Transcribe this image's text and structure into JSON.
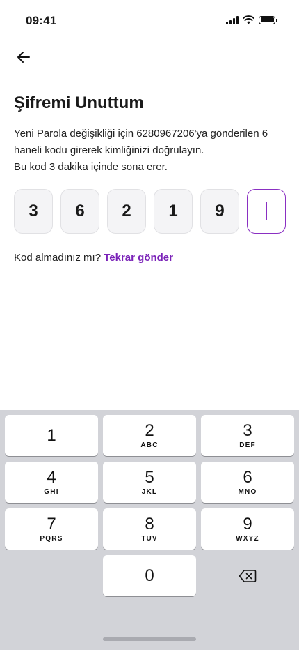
{
  "status_bar": {
    "time": "09:41"
  },
  "header": {
    "back_icon": "arrow-left-icon"
  },
  "content": {
    "title": "Şifremi Unuttum",
    "description_line1": "Yeni Parola değişikliği için 6280967206'ya gönderilen 6 haneli kodu girerek kimliğinizi doğrulayın.",
    "description_line2": "Bu kod 3 dakika içinde sona erer."
  },
  "otp": {
    "digits": [
      "3",
      "6",
      "2",
      "1",
      "9",
      ""
    ],
    "active_index": 5
  },
  "resend": {
    "prompt": "Kod almadınız mı?",
    "link": "Tekrar gönder"
  },
  "keypad": {
    "keys": [
      {
        "num": "1",
        "letters": ""
      },
      {
        "num": "2",
        "letters": "ABC"
      },
      {
        "num": "3",
        "letters": "DEF"
      },
      {
        "num": "4",
        "letters": "GHI"
      },
      {
        "num": "5",
        "letters": "JKL"
      },
      {
        "num": "6",
        "letters": "MNO"
      },
      {
        "num": "7",
        "letters": "PQRS"
      },
      {
        "num": "8",
        "letters": "TUV"
      },
      {
        "num": "9",
        "letters": "WXYZ"
      },
      {
        "num": "0",
        "letters": ""
      }
    ],
    "delete_icon": "backspace-icon"
  },
  "colors": {
    "accent": "#7a22b8",
    "otp_bg": "#f4f4f6",
    "keypad_bg": "#d2d3d8"
  }
}
